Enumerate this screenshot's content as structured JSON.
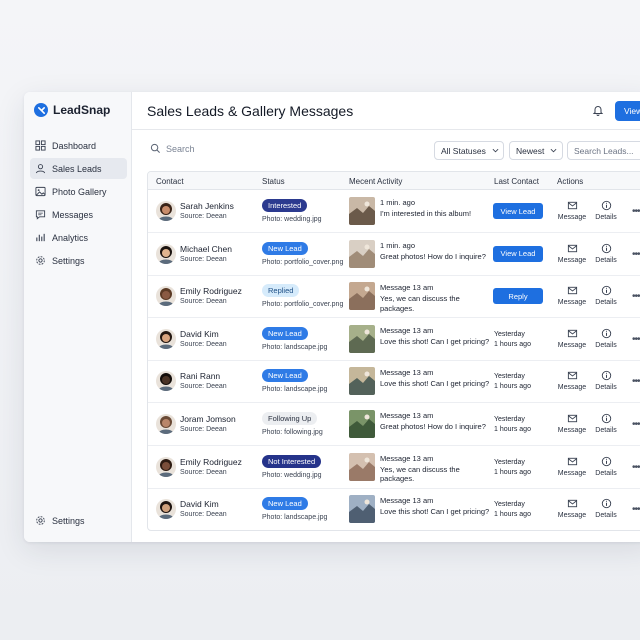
{
  "app": {
    "name": "LeadSnap"
  },
  "sidebar": {
    "items": [
      {
        "label": "Dashboard",
        "icon": "grid-icon"
      },
      {
        "label": "Sales Leads",
        "icon": "user-icon",
        "active": true
      },
      {
        "label": "Photo Gallery",
        "icon": "image-icon"
      },
      {
        "label": "Messages",
        "icon": "chat-icon"
      },
      {
        "label": "Analytics",
        "icon": "bar-chart-icon"
      },
      {
        "label": "Settings",
        "icon": "gear-icon"
      }
    ],
    "bottom": {
      "label": "Settings",
      "icon": "gear-icon"
    }
  },
  "header": {
    "title": "Sales Leads & Gallery Messages",
    "view_button": "View L"
  },
  "toolbar": {
    "search_placeholder": "Search",
    "status_filter": "All Statuses",
    "sort": "Newest",
    "search_leads_placeholder": "Search Leads..."
  },
  "table": {
    "columns": {
      "contact": "Contact",
      "status": "Status",
      "activity": "Mecent Activity",
      "last_contact": "Last Contact",
      "actions": "Actions"
    },
    "action_labels": {
      "message": "Message",
      "details": "Details"
    },
    "rows": [
      {
        "name": "Sarah Jenkins",
        "source": "Source: Deean",
        "status": "Interested",
        "status_style": "dark",
        "photo": "Photo: wedding.jpg",
        "activity_time": "1 min. ago",
        "activity_text": "I'm interested in this album!",
        "last_button": "View Lead"
      },
      {
        "name": "Michael Chen",
        "source": "Source: Deean",
        "status": "New Lead",
        "status_style": "blue",
        "photo": "Photo: portfolio_cover.png",
        "activity_time": "1 min. ago",
        "activity_text": "Great photos! How do I inquire?",
        "last_button": "View Lead"
      },
      {
        "name": "Emily Rodriguez",
        "source": "Source: Deean",
        "status": "Replied",
        "status_style": "light",
        "photo": "Photo: portfolio_cover.png",
        "activity_time": "Message 13 am",
        "activity_text": "Yes, we can discuss the packages.",
        "last_button": "Reply"
      },
      {
        "name": "David Kim",
        "source": "Source: Deean",
        "status": "New Lead",
        "status_style": "blue",
        "photo": "Photo: landscape.jpg",
        "activity_time": "Message 13 am",
        "activity_text": "Love this shot! Can I get pricing?",
        "last_line1": "Yesterday",
        "last_line2": "1 hours ago"
      },
      {
        "name": "Rani Rann",
        "source": "Source: Deean",
        "status": "New Lead",
        "status_style": "blue",
        "photo": "Photo: landscape.jpg",
        "activity_time": "Message 13 am",
        "activity_text": "Love this shot! Can I get pricing?",
        "last_line1": "Yesterday",
        "last_line2": "1 hours ago"
      },
      {
        "name": "Joram Jomson",
        "source": "Source: Deean",
        "status": "Following Up",
        "status_style": "gray",
        "photo": "Photo: following.jpg",
        "activity_time": "Message 13 am",
        "activity_text": "Great photos! How do I inquire?",
        "last_line1": "Yesterday",
        "last_line2": "1 hours ago"
      },
      {
        "name": "Emily Rodriguez",
        "source": "Source: Deean",
        "status": "Not Interested",
        "status_style": "navy",
        "photo": "Photo: wedding.jpg",
        "activity_time": "Message 13 am",
        "activity_text": "Yes, we can discuss the packages.",
        "last_line1": "Yesterday",
        "last_line2": "1 hours ago"
      },
      {
        "name": "David Kim",
        "source": "Source: Deean",
        "status": "New Lead",
        "status_style": "blue",
        "photo": "Photo: landscape.jpg",
        "activity_time": "Message 13 am",
        "activity_text": "Love this shot! Can I get pricing?",
        "last_line1": "Yesterday",
        "last_line2": "1 hours ago"
      }
    ]
  },
  "colors": {
    "accent": "#1e6fe0",
    "badge_dark": "#2b3a8f",
    "badge_blue": "#2f7be6",
    "badge_light": "#d6ebfb",
    "badge_gray": "#eceef1",
    "badge_navy": "#25338a"
  }
}
